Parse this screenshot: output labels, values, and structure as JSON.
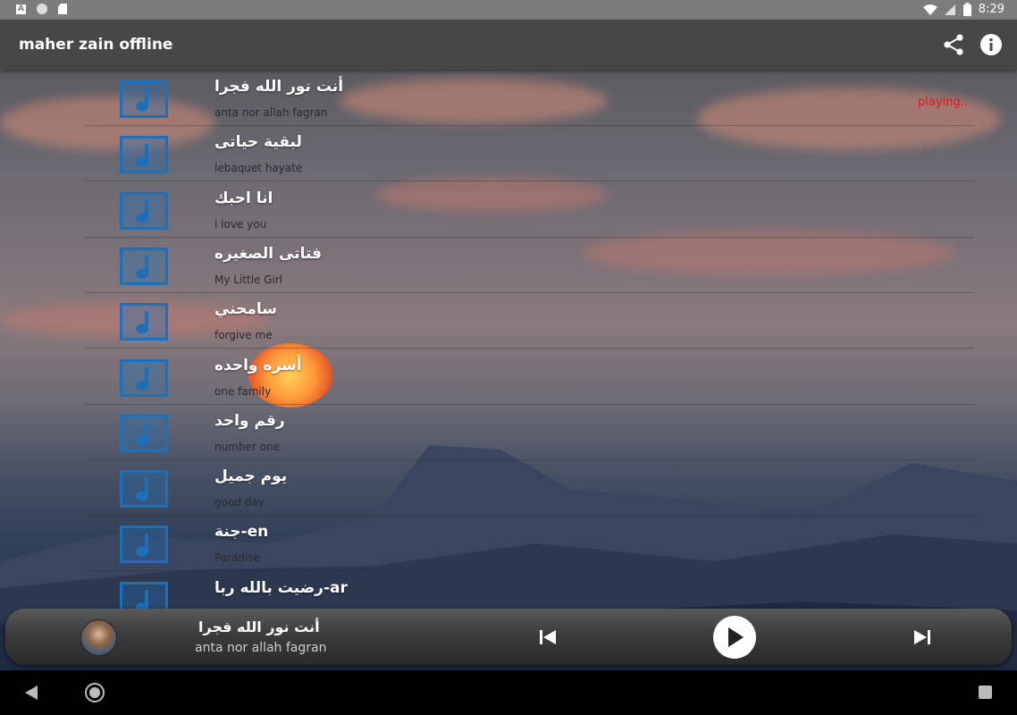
{
  "status_bar": {
    "time": "8:29",
    "left_icons": [
      "app-a-icon",
      "circle-icon",
      "sd-card-icon"
    ],
    "right_icons": [
      "wifi-icon",
      "signal-icon",
      "battery-icon"
    ]
  },
  "app_bar": {
    "title": "maher zain offline",
    "actions": [
      "share-icon",
      "info-icon"
    ]
  },
  "colors": {
    "accent": "#1f6fb8",
    "playing": "#e0141a",
    "app_bar": "#474747"
  },
  "songs": [
    {
      "title": "أنت نور الله فجرا",
      "subtitle": "anta nor allah fagran",
      "status": "playing.."
    },
    {
      "title": "لبقية حياتى",
      "subtitle": "lebaquet hayate",
      "status": ""
    },
    {
      "title": "انا احبك",
      "subtitle": "i love you",
      "status": ""
    },
    {
      "title": "فتاتى الصغيره",
      "subtitle": "My Little Girl",
      "status": ""
    },
    {
      "title": "سامحني",
      "subtitle": "forgive me",
      "status": ""
    },
    {
      "title": "أسره واحده",
      "subtitle": "one family",
      "status": ""
    },
    {
      "title": "رقم واحد",
      "subtitle": "number one",
      "status": ""
    },
    {
      "title": "يوم جميل",
      "subtitle": "good day",
      "status": ""
    },
    {
      "title": "جنة-en",
      "subtitle": "Paradise",
      "status": ""
    },
    {
      "title": "رضيت بالله ربا-ar",
      "subtitle": "",
      "status": ""
    }
  ],
  "player": {
    "title": "أنت نور الله فجرا",
    "subtitle": "anta nor allah fagran",
    "controls": [
      "skip-previous-icon",
      "play-icon",
      "skip-next-icon"
    ]
  },
  "nav_bar": {
    "buttons": [
      "back-icon",
      "home-icon",
      "recents-icon"
    ]
  }
}
